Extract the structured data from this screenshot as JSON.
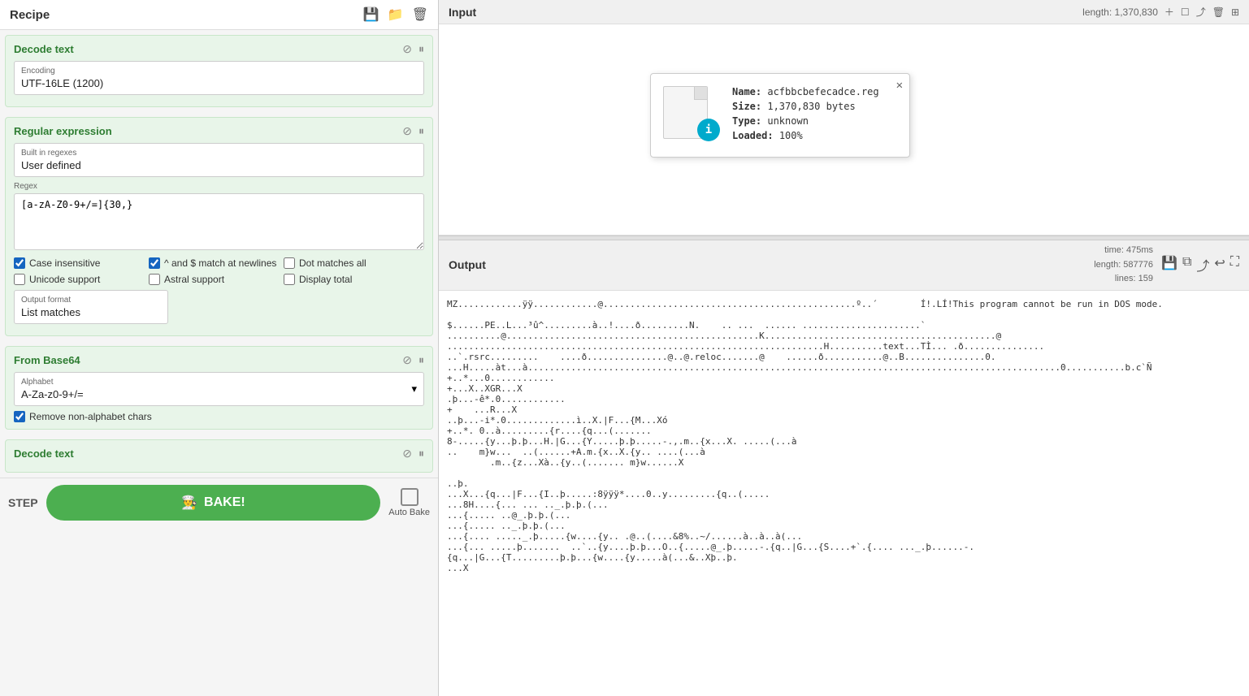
{
  "recipe": {
    "title": "Recipe",
    "icons": [
      "save",
      "folder",
      "trash"
    ]
  },
  "decode_text_top": {
    "title": "Decode text",
    "encoding_label": "Encoding",
    "encoding_value": "UTF-16LE (1200)"
  },
  "regular_expression": {
    "title": "Regular expression",
    "built_in_label": "Built in regexes",
    "built_in_value": "User defined",
    "regex_label": "Regex",
    "regex_value": "[a-zA-Z0-9+/=]{30,}"
  },
  "checkboxes": {
    "case_insensitive": {
      "label": "Case insensitive",
      "checked": true
    },
    "caret_dollar": {
      "label": "^ and $ match at newlines",
      "checked": true
    },
    "dot_matches": {
      "label": "Dot matches all",
      "checked": false
    },
    "unicode_support": {
      "label": "Unicode support",
      "checked": false
    },
    "astral_support": {
      "label": "Astral support",
      "checked": false
    },
    "display_total": {
      "label": "Display total",
      "checked": false
    }
  },
  "output_format": {
    "label": "Output format",
    "value": "List matches"
  },
  "from_base64": {
    "title": "From Base64",
    "alphabet_label": "Alphabet",
    "alphabet_value": "A-Za-z0-9+/=",
    "remove_label": "Remove non-alphabet chars",
    "remove_checked": true
  },
  "decode_text_bottom": {
    "title": "Decode text"
  },
  "bottom_bar": {
    "step": "STEP",
    "bake": "BAKE!",
    "auto_bake": "Auto Bake"
  },
  "input_panel": {
    "title": "Input",
    "length_info": "length: 1,370,830",
    "icons": [
      "plus",
      "expand",
      "export",
      "trash",
      "grid"
    ]
  },
  "file_info": {
    "name_label": "Name:",
    "name_value": "acfbbcbefecadce.reg",
    "size_label": "Size:",
    "size_value": "1,370,830 bytes",
    "type_label": "Type:",
    "type_value": "unknown",
    "loaded_label": "Loaded:",
    "loaded_value": "100%"
  },
  "output_panel": {
    "title": "Output",
    "time": "time:  475ms",
    "length": "length: 587776",
    "lines": "lines:  159",
    "content": "MZ............ÿÿ............@...............................................º..´\tÍ!.LÍ!This program cannot be run in DOS mode.\n\n$......PE..L...³û^.........à..!....ð.........N.    .. ...  ...... ......................`\n..........@...............................................K...........................................@\n......................................................................H..........text...TÌ... .ð...............\n..`.rsrc.........    ....ð...............@..@.reloc.......@    ......ð...........@..B...............0.\n...H.....àt...à...................................................................................................0...........b.c`Ñ\n+..*...0............\n+...X..XGR...X\n.þ...-ê*.0............\n+    ...R...X\n..þ...-i*.0.............ì..X.|F...{M...Xó\n+..*. 0..à.........{r....{q...(.......\n8-.....{y...þ.þ...H.|G...{Y.....þ.þ.....-.,.m..{x...X. .....(...à\n..    m}w...  ..(......+A.m.{x..X.{y.. ....(...à\n        .m..{z...Xà..{y..(....... m}w......X\n\n..þ.\n...X...{q...|F...{I..þ.....:8ÿÿÿ*....0..y.........{q..(.....\n...8H....{... ... .._.þ.þ.(...\n...{..... ..@_.þ.þ.(...\n...{..... .._.þ.þ.(...\n...{.... ....._.þ.....{w....{y.. .@..(....&8%..~/......à..à..à(...\n...{... .....þ.......  ..`..{y....þ.þ...O..{.....@_.þ.....-.{q..|G...{S....+`.{.... ..._.þ......-.\n{q...|G...{T.........þ.þ...{w....{y.....à(...&..Xþ..þ.\n...X"
  }
}
